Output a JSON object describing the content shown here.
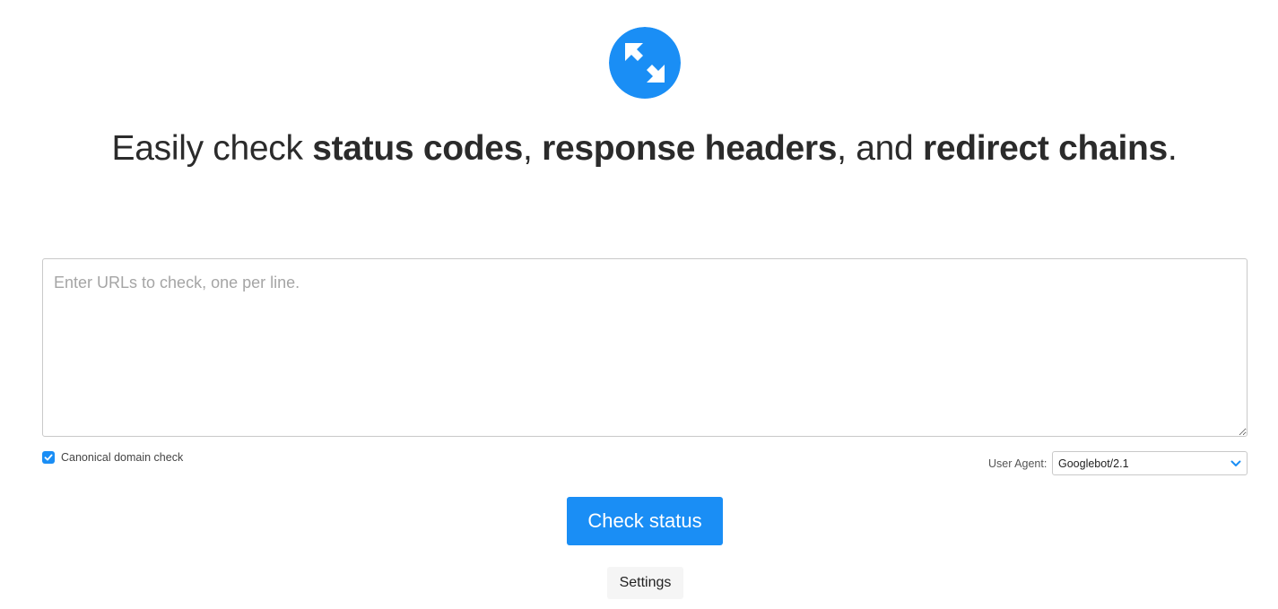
{
  "logo": {
    "icon": "compress-arrows-icon",
    "color": "#1a8ef5"
  },
  "headline": {
    "part1": "Easily check ",
    "bold1": "status codes",
    "part2": ", ",
    "bold2": "response headers",
    "part3": ", and ",
    "bold3": "redirect chains",
    "part4": "."
  },
  "url_input": {
    "placeholder": "Enter URLs to check, one per line.",
    "value": ""
  },
  "canonical_check": {
    "label": "Canonical domain check",
    "checked": true
  },
  "user_agent": {
    "label": "User Agent:",
    "selected": "Googlebot/2.1"
  },
  "buttons": {
    "check_status": "Check status",
    "settings": "Settings"
  },
  "colors": {
    "accent": "#1a8ef5",
    "text": "#2b2b2b"
  }
}
